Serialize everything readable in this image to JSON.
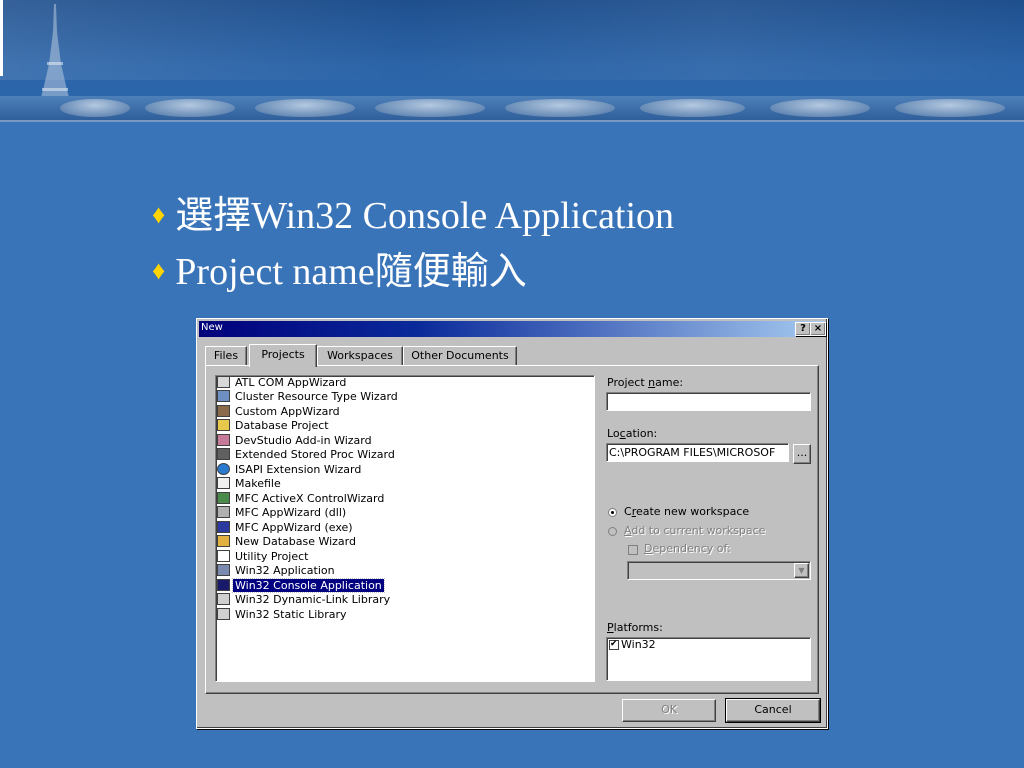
{
  "bullets": [
    "選擇Win32 Console Application",
    "Project name隨便輸入"
  ],
  "dialog": {
    "title": "New",
    "title_buttons": [
      "?",
      "×"
    ],
    "tabs": [
      "Files",
      "Projects",
      "Workspaces",
      "Other Documents"
    ],
    "active_tab": "Projects",
    "projects": [
      "ATL COM AppWizard",
      "Cluster Resource Type Wizard",
      "Custom AppWizard",
      "Database Project",
      "DevStudio Add-in Wizard",
      "Extended Stored Proc Wizard",
      "ISAPI Extension Wizard",
      "Makefile",
      "MFC ActiveX ControlWizard",
      "MFC AppWizard (dll)",
      "MFC AppWizard (exe)",
      "New Database Wizard",
      "Utility Project",
      "Win32 Application",
      "Win32 Console Application",
      "Win32 Dynamic-Link Library",
      "Win32 Static Library"
    ],
    "selected_project": "Win32 Console Application",
    "project_name_label": {
      "pre": "Project ",
      "key": "n",
      "post": "ame:"
    },
    "project_name_value": "",
    "location_label": {
      "pre": "Lo",
      "key": "c",
      "post": "ation:"
    },
    "location_value": "C:\\PROGRAM FILES\\MICROSOF",
    "browse_label": "...",
    "create_new_workspace": {
      "pre": "C",
      "key": "r",
      "post": "eate new workspace"
    },
    "add_to_workspace": {
      "pre": "",
      "key": "A",
      "post": "dd to current workspace"
    },
    "dependency_of": {
      "pre": "",
      "key": "D",
      "post": "ependency of:"
    },
    "platforms_label": {
      "pre": "",
      "key": "P",
      "post": "latforms:"
    },
    "platforms": [
      "Win32"
    ],
    "ok_label": "OK",
    "cancel_label": "Cancel"
  },
  "colors": {
    "slide_background": "#3a74b8",
    "bullet_diamond": "#ffd400",
    "title_bar": "#00007b",
    "selection": "#000080"
  }
}
